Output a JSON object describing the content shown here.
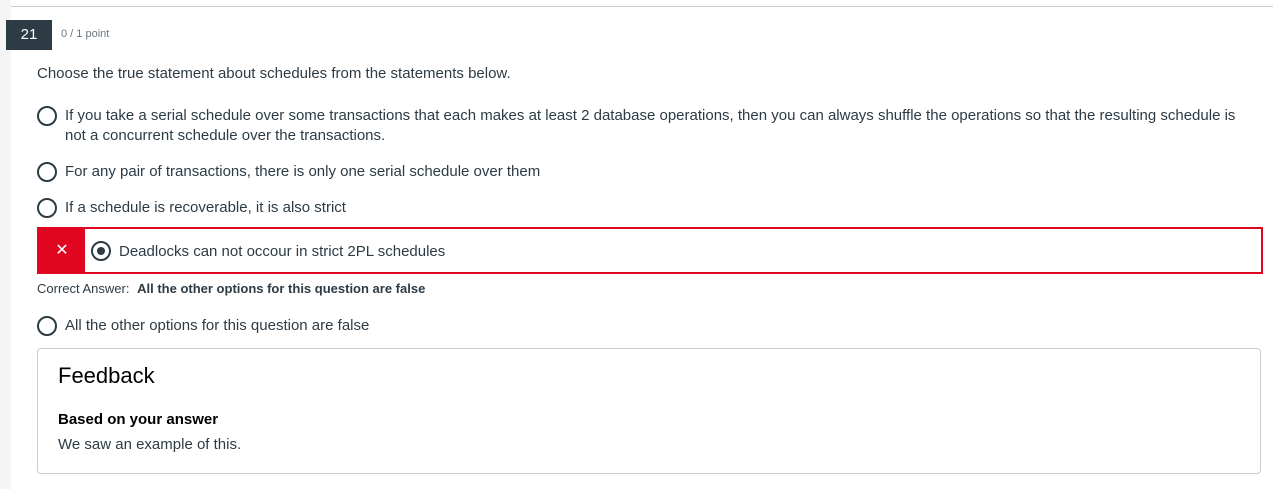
{
  "question": {
    "number": "21",
    "points": "0 / 1 point",
    "prompt": "Choose the true statement about schedules from the statements below."
  },
  "options": [
    {
      "text": "If you take a serial schedule over some transactions that each makes at least 2 database operations, then you can always shuffle the operations so that the resulting schedule is not a concurrent schedule over the transactions.",
      "selected": false
    },
    {
      "text": "For any pair of transactions, there is only one serial schedule over them",
      "selected": false
    },
    {
      "text": "If a schedule is recoverable, it is also strict",
      "selected": false
    },
    {
      "text": "Deadlocks can not occour in strict 2PL schedules",
      "selected": true,
      "marked_wrong": true
    },
    {
      "text": "All the other options for this question are false",
      "selected": false
    }
  ],
  "wrong_icon": "close-icon",
  "correct_answer": {
    "label": "Correct Answer:",
    "value": "All the other options for this question are false"
  },
  "feedback": {
    "title": "Feedback",
    "subtitle": "Based on your answer",
    "text": "We saw an example of this."
  },
  "colors": {
    "dark": "#2d3b45",
    "error": "#e0061f",
    "border": "#c7cdd1"
  }
}
